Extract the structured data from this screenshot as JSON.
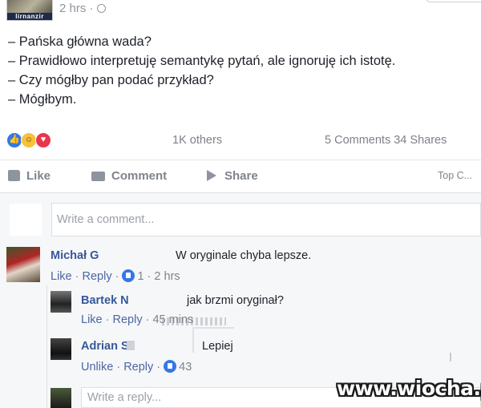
{
  "post": {
    "author_avatar_tag": "lirnanzir",
    "time": "2 hrs ·",
    "lines": [
      "– Pańska główna wada?",
      "– Prawidłowo interpretuję semantykę pytań, ale ignoruję ich istotę.",
      "– Czy mógłby pan podać przykład?",
      "– Mógłbym."
    ]
  },
  "stats": {
    "others": "1K others",
    "comments": "5 Comments",
    "shares": "34 Shares"
  },
  "actions": {
    "like": "Like",
    "comment": "Comment",
    "share": "Share",
    "top_comments": "Top C..."
  },
  "composer": {
    "placeholder": "Write a comment..."
  },
  "comments": [
    {
      "name": "Michał G",
      "text": "W oryginale chyba lepsze.",
      "like": "Like",
      "reply": "Reply",
      "likes": "1",
      "time": "2 hrs"
    }
  ],
  "replies": [
    {
      "name": "Bartek N",
      "text": "jak brzmi oryginał?",
      "like": "Like",
      "reply": "Reply",
      "time": "45 mins"
    },
    {
      "name": "Adrian S",
      "text": "Lepiej",
      "like": "Unlike",
      "reply": "Reply",
      "likes": "43"
    }
  ],
  "reply_composer": {
    "placeholder": "Write a reply..."
  },
  "watermark": "www.wiocha.pl",
  "colors": {
    "link_blue": "#365899",
    "meta_gray": "#7f848c",
    "like_blue": "#3578e5",
    "love_red": "#e9364b",
    "haha_yellow": "#f7c13b"
  }
}
